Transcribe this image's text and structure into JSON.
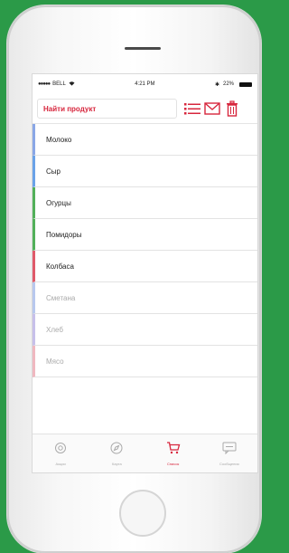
{
  "status": {
    "carrier": "BELL",
    "time": "4:21 PM",
    "battery": "22%"
  },
  "toolbar": {
    "search_placeholder": "Найти продукт"
  },
  "accent_color": "#d7263d",
  "items": [
    {
      "label": "Молоко",
      "color": "#8aa7e6",
      "faded": false
    },
    {
      "label": "Сыр",
      "color": "#6aa2e8",
      "faded": false
    },
    {
      "label": "Огурцы",
      "color": "#52b05a",
      "faded": false
    },
    {
      "label": "Помидоры",
      "color": "#52b05a",
      "faded": false
    },
    {
      "label": "Колбаса",
      "color": "#e05a6a",
      "faded": false
    },
    {
      "label": "Сметана",
      "color": "#b8c8ee",
      "faded": true
    },
    {
      "label": "Хлеб",
      "color": "#c7c0ea",
      "faded": true
    },
    {
      "label": "Мясо",
      "color": "#f0b8c0",
      "faded": true
    }
  ],
  "tabs": [
    {
      "label": "Акции",
      "icon": "settings-icon",
      "active": false
    },
    {
      "label": "Карта",
      "icon": "compass-icon",
      "active": false
    },
    {
      "label": "Список",
      "icon": "cart-icon",
      "active": true
    },
    {
      "label": "Сообщения",
      "icon": "message-icon",
      "active": false
    }
  ]
}
